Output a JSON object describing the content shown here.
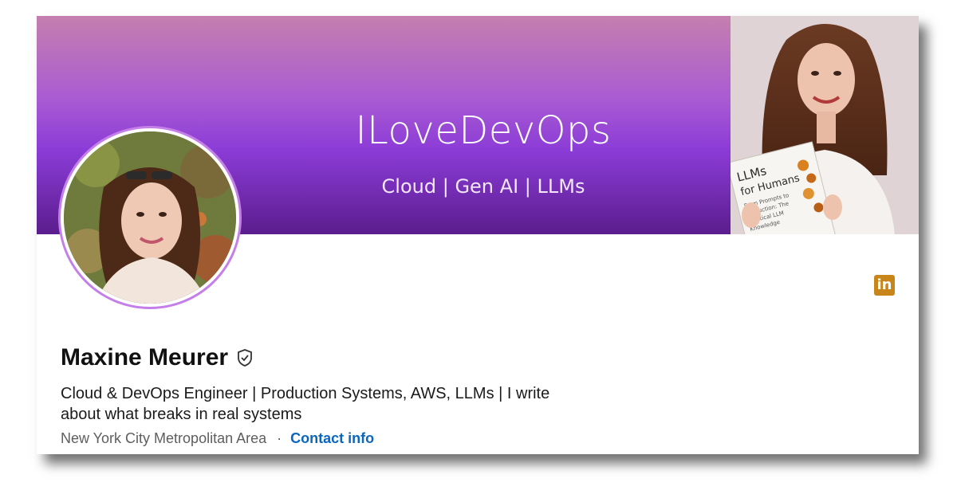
{
  "banner": {
    "title": "ILoveDevOps",
    "subtitle": "Cloud | Gen AI | LLMs",
    "photo_icon": "person-holding-book-photo"
  },
  "profile": {
    "photo_icon": "profile-avatar-photo",
    "name": "Maxine Meurer",
    "verified_icon": "shield-check-icon",
    "headline": "Cloud & DevOps Engineer | Production Systems, AWS, LLMs | I write about what breaks in real systems",
    "location": "New York City Metropolitan Area",
    "separator": "·",
    "contact_label": "Contact info"
  },
  "brand": {
    "icon": "linkedin-icon",
    "label": "in",
    "color": "#c8861a"
  },
  "colors": {
    "accent_link": "#0a66c2",
    "banner_purple": "#8b3bd6",
    "avatar_ring": "#c47fe8"
  }
}
